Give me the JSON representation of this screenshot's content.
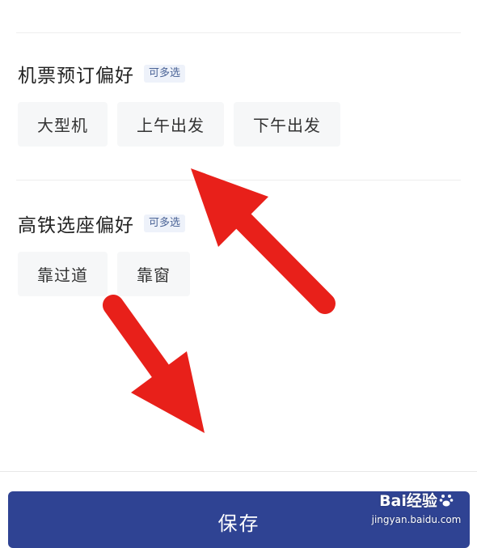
{
  "sections": [
    {
      "title": "机票预订偏好",
      "badge": "可多选",
      "options": [
        "大型机",
        "上午出发",
        "下午出发"
      ]
    },
    {
      "title": "高铁选座偏好",
      "badge": "可多选",
      "options": [
        "靠过道",
        "靠窗"
      ]
    }
  ],
  "footer": {
    "save_label": "保存"
  },
  "watermark": {
    "brand": "Bai经验",
    "url": "jingyan.baidu.com"
  },
  "colors": {
    "primary": "#2f4393",
    "chip_bg": "#f6f7f8",
    "badge_text": "#4a6396",
    "badge_bg": "#eef2fa",
    "arrow": "#e8201a"
  },
  "icons": {
    "annotation": "red-arrow-icon",
    "watermark_logo": "baidu-paw-icon"
  }
}
